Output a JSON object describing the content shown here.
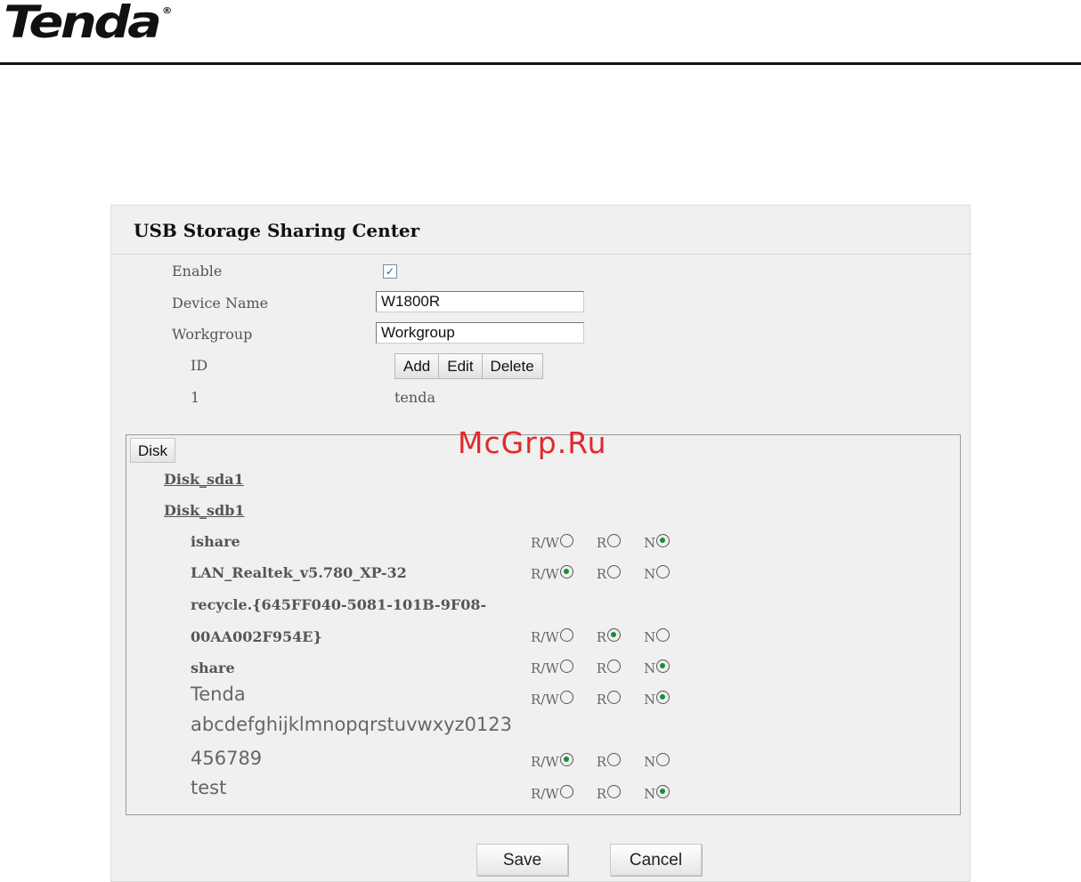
{
  "brand": {
    "logo_text": "Tenda",
    "registered_mark": "®"
  },
  "watermark": "McGrp.Ru",
  "panel": {
    "title": "USB Storage Sharing Center",
    "enable": {
      "label": "Enable",
      "checked": true,
      "check_glyph": "✓"
    },
    "device_name": {
      "label": "Device Name",
      "value": "W1800R"
    },
    "workgroup": {
      "label": "Workgroup",
      "value": "Workgroup"
    },
    "user_table": {
      "id_header": "ID",
      "buttons": {
        "add": "Add",
        "edit": "Edit",
        "delete": "Delete"
      },
      "rows": [
        {
          "id": "1",
          "name": "tenda"
        }
      ]
    },
    "disk": {
      "tab_label": "Disk",
      "disks": [
        "Disk_sda1",
        "Disk_sdb1"
      ],
      "permission_labels": {
        "rw": "R/W",
        "r": "R",
        "n": "N"
      },
      "folders": [
        {
          "name": "ishare",
          "selected": "n"
        },
        {
          "name": "LAN_Realtek_v5.780_XP-32",
          "selected": "rw"
        },
        {
          "name_line1": "recycle.{645FF040-5081-101B-9F08-",
          "name_line2": "00AA002F954E}",
          "selected": "r"
        },
        {
          "name": "share",
          "selected": "n"
        },
        {
          "name": "Tenda",
          "selected": "n"
        },
        {
          "name_line1": "abcdefghijklmnopqrstuvwxyz0123",
          "name_line2": "456789",
          "selected": "rw"
        },
        {
          "name": "test",
          "selected": "n"
        }
      ]
    },
    "actions": {
      "save": "Save",
      "cancel": "Cancel"
    }
  }
}
